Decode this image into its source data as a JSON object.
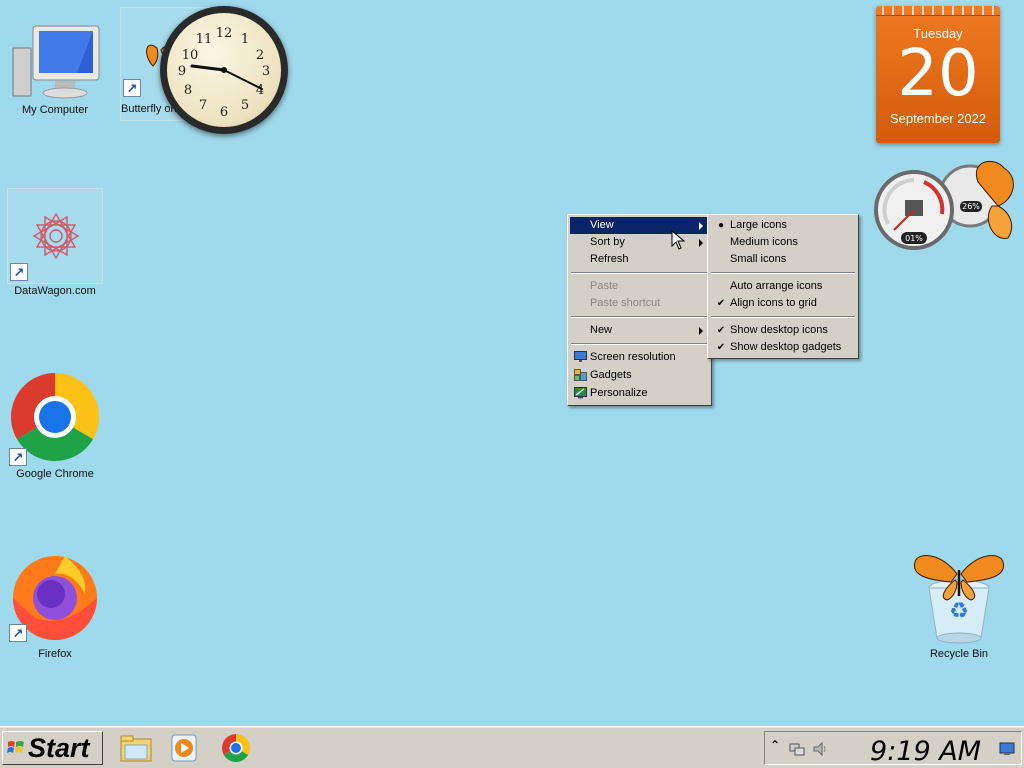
{
  "desktop": {
    "icons": [
      {
        "label": "My Computer"
      },
      {
        "label": "Butterfly on D"
      },
      {
        "label": "DataWagon.com"
      },
      {
        "label": "Google Chrome"
      },
      {
        "label": "Firefox"
      },
      {
        "label": "Recycle Bin"
      }
    ]
  },
  "gadgets": {
    "clock": {
      "numerals": [
        "12",
        "1",
        "2",
        "3",
        "4",
        "5",
        "6",
        "7",
        "8",
        "9",
        "10",
        "11"
      ]
    },
    "calendar": {
      "day_of_week": "Tuesday",
      "day": "20",
      "month_year": "September 2022"
    },
    "meter": {
      "cpu": "01%",
      "memory": "26%"
    }
  },
  "context_menu": {
    "items": [
      {
        "label": "View"
      },
      {
        "label": "Sort by"
      },
      {
        "label": "Refresh"
      },
      {
        "label": "Paste"
      },
      {
        "label": "Paste shortcut"
      },
      {
        "label": "New"
      },
      {
        "label": "Screen resolution"
      },
      {
        "label": "Gadgets"
      },
      {
        "label": "Personalize"
      }
    ]
  },
  "view_submenu": {
    "items": [
      {
        "label": "Large icons"
      },
      {
        "label": "Medium icons"
      },
      {
        "label": "Small icons"
      },
      {
        "label": "Auto arrange icons"
      },
      {
        "label": "Align icons to grid"
      },
      {
        "label": "Show desktop icons"
      },
      {
        "label": "Show desktop gadgets"
      }
    ]
  },
  "taskbar": {
    "start_label": "Start",
    "time": "9:19 AM"
  },
  "colors": {
    "desktop_bg": "#9fd9ec",
    "menu_highlight": "#0a246a",
    "calendar_orange": "#e86a16"
  }
}
